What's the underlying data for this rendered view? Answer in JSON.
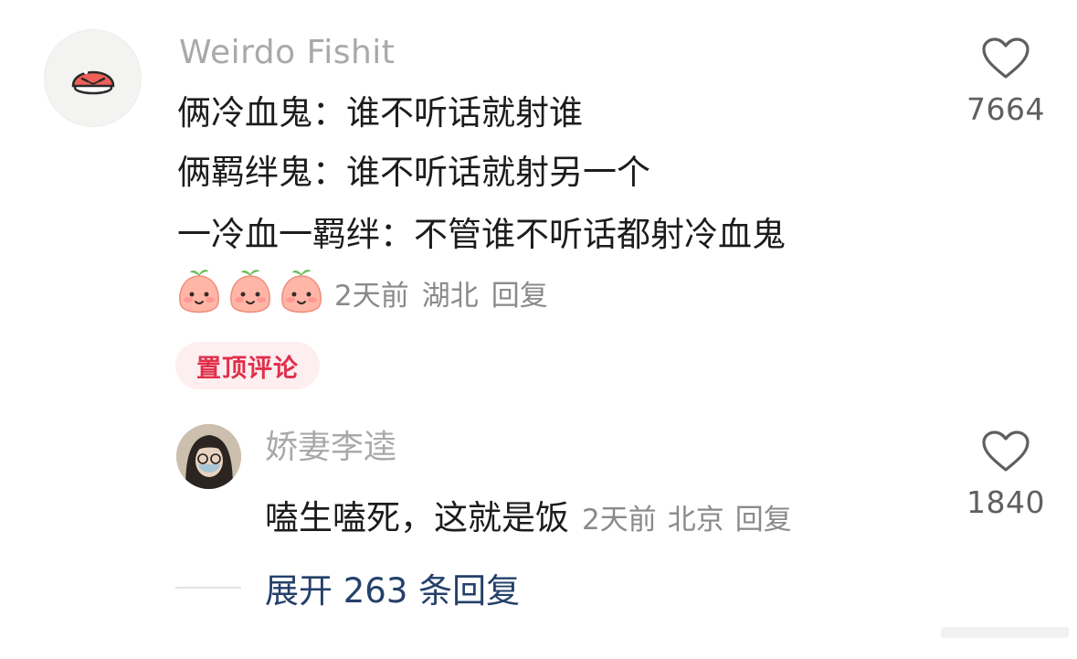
{
  "main_comment": {
    "username": "Weirdo Fishit",
    "lines": [
      "俩冷血鬼：谁不听话就射谁",
      "俩羁绊鬼：谁不听话就射另一个",
      "一冷血一羁绊：不管谁不听话都射冷血鬼"
    ],
    "emoji_icons": [
      "peach-face-emoji",
      "peach-face-emoji",
      "peach-face-emoji"
    ],
    "time": "2天前",
    "location": "湖北",
    "reply_label": "回复",
    "pinned_label": "置顶评论",
    "like_count": "7664"
  },
  "reply_comment": {
    "username": "娇妻李逵",
    "text": "嗑生嗑死，这就是饭",
    "time": "2天前",
    "location": "北京",
    "reply_label": "回复",
    "like_count": "1840"
  },
  "expand": {
    "label": "展开 263 条回复"
  },
  "colors": {
    "username": "#a9a9a9",
    "body_text": "#1c1c1c",
    "meta": "#8a8a8a",
    "pin_bg": "#fdeef0",
    "pin_text": "#e0304b",
    "expand_link": "#24406a"
  }
}
